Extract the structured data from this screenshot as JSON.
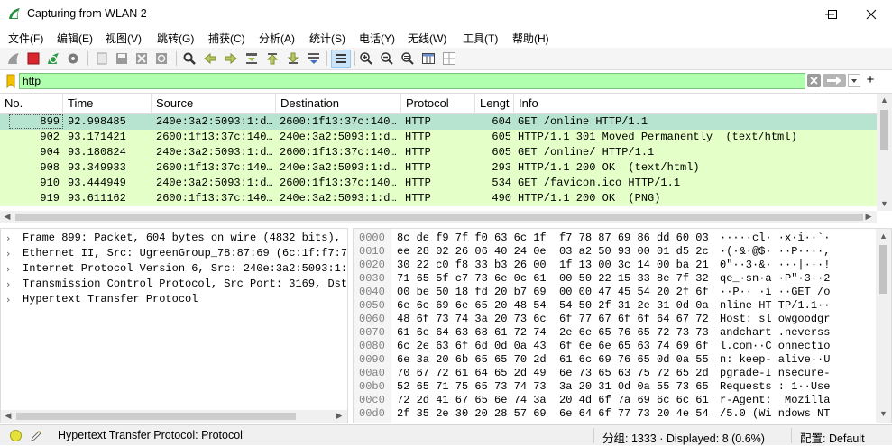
{
  "window": {
    "title": "Capturing from WLAN 2",
    "controls": [
      "minimize-icon",
      "maximize-icon",
      "close-icon"
    ]
  },
  "menu": [
    "文件(F)",
    "编辑(E)",
    "视图(V)",
    "跳转(G)",
    "捕获(C)",
    "分析(A)",
    "统计(S)",
    "电话(Y)",
    "无线(W)",
    "工具(T)",
    "帮助(H)"
  ],
  "filter": {
    "value": "http",
    "valid_color": "#afffaf"
  },
  "packet_list": {
    "columns": [
      "No.",
      "Time",
      "Source",
      "Destination",
      "Protocol",
      "Lengt",
      "Info"
    ],
    "rows": [
      {
        "no": "899",
        "time": "92.998485",
        "src": "240e:3a2:5093:1:d…",
        "dst": "2600:1f13:37c:140…",
        "proto": "HTTP",
        "len": "604",
        "info": "GET /online HTTP/1.1",
        "selected": true
      },
      {
        "no": "902",
        "time": "93.171421",
        "src": "2600:1f13:37c:140…",
        "dst": "240e:3a2:5093:1:d…",
        "proto": "HTTP",
        "len": "605",
        "info": "HTTP/1.1 301 Moved Permanently  (text/html)",
        "selected": false
      },
      {
        "no": "904",
        "time": "93.180824",
        "src": "240e:3a2:5093:1:d…",
        "dst": "2600:1f13:37c:140…",
        "proto": "HTTP",
        "len": "605",
        "info": "GET /online/ HTTP/1.1",
        "selected": false
      },
      {
        "no": "908",
        "time": "93.349933",
        "src": "2600:1f13:37c:140…",
        "dst": "240e:3a2:5093:1:d…",
        "proto": "HTTP",
        "len": "293",
        "info": "HTTP/1.1 200 OK  (text/html)",
        "selected": false
      },
      {
        "no": "910",
        "time": "93.444949",
        "src": "240e:3a2:5093:1:d…",
        "dst": "2600:1f13:37c:140…",
        "proto": "HTTP",
        "len": "534",
        "info": "GET /favicon.ico HTTP/1.1",
        "selected": false
      },
      {
        "no": "919",
        "time": "93.611162",
        "src": "2600:1f13:37c:140…",
        "dst": "240e:3a2:5093:1:d…",
        "proto": "HTTP",
        "len": "490",
        "info": "HTTP/1.1 200 OK  (PNG)",
        "selected": false
      }
    ],
    "row_color": "#e4ffc7",
    "selected_color": "#b7e4d0"
  },
  "details": [
    "Frame 899: Packet, 604 bytes on wire (4832 bits), 6",
    "Ethernet II, Src: UgreenGroup_78:87:69 (6c:1f:f7:78",
    "Internet Protocol Version 6, Src: 240e:3a2:5093:1:d",
    "Transmission Control Protocol, Src Port: 3169, Dst P",
    "Hypertext Transfer Protocol"
  ],
  "bytes": [
    {
      "offset": "0000",
      "hex": "8c de f9 7f f0 63 6c 1f  f7 78 87 69 86 dd 60 03",
      "ascii": "·····cl· ·x·i··`·"
    },
    {
      "offset": "0010",
      "hex": "ee 28 02 26 06 40 24 0e  03 a2 50 93 00 01 d5 2c",
      "ascii": "·(·&·@$· ··P····,"
    },
    {
      "offset": "0020",
      "hex": "30 22 c0 f8 33 b3 26 00  1f 13 00 3c 14 00 ba 21",
      "ascii": "0\"··3·&· ···|···!"
    },
    {
      "offset": "0030",
      "hex": "71 65 5f c7 73 6e 0c 61  00 50 22 15 33 8e 7f 32",
      "ascii": "qe_·sn·a ·P\"·3··2"
    },
    {
      "offset": "0040",
      "hex": "00 be 50 18 fd 20 b7 69  00 00 47 45 54 20 2f 6f",
      "ascii": "··P·· ·i ··GET /o"
    },
    {
      "offset": "0050",
      "hex": "6e 6c 69 6e 65 20 48 54  54 50 2f 31 2e 31 0d 0a",
      "ascii": "nline HT TP/1.1··"
    },
    {
      "offset": "0060",
      "hex": "48 6f 73 74 3a 20 73 6c  6f 77 67 6f 6f 64 67 72",
      "ascii": "Host: sl owgoodgr"
    },
    {
      "offset": "0070",
      "hex": "61 6e 64 63 68 61 72 74  2e 6e 65 76 65 72 73 73",
      "ascii": "andchart .neverss"
    },
    {
      "offset": "0080",
      "hex": "6c 2e 63 6f 6d 0d 0a 43  6f 6e 6e 65 63 74 69 6f",
      "ascii": "l.com··C onnectio"
    },
    {
      "offset": "0090",
      "hex": "6e 3a 20 6b 65 65 70 2d  61 6c 69 76 65 0d 0a 55",
      "ascii": "n: keep- alive··U"
    },
    {
      "offset": "00a0",
      "hex": "70 67 72 61 64 65 2d 49  6e 73 65 63 75 72 65 2d",
      "ascii": "pgrade-I nsecure-"
    },
    {
      "offset": "00b0",
      "hex": "52 65 71 75 65 73 74 73  3a 20 31 0d 0a 55 73 65",
      "ascii": "Requests : 1··Use"
    },
    {
      "offset": "00c0",
      "hex": "72 2d 41 67 65 6e 74 3a  20 4d 6f 7a 69 6c 6c 61",
      "ascii": "r-Agent:  Mozilla"
    },
    {
      "offset": "00d0",
      "hex": "2f 35 2e 30 20 28 57 69  6e 64 6f 77 73 20 4e 54",
      "ascii": "/5.0 (Wi ndows NT"
    }
  ],
  "status": {
    "expert_info": "Hypertext Transfer Protocol: Protocol",
    "packets": "分组: 1333 · Displayed: 8 (0.6%)",
    "profile": "配置: Default"
  }
}
